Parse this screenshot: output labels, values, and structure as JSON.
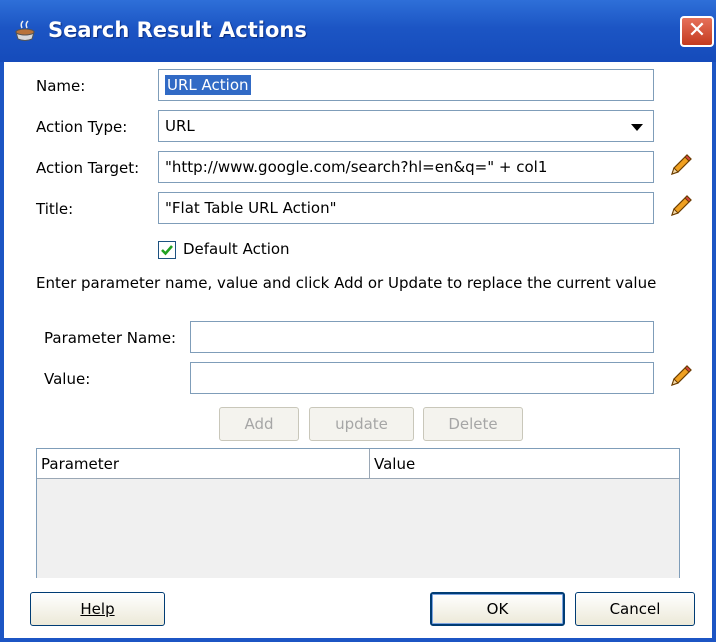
{
  "window": {
    "title": "Search Result Actions",
    "close_glyph": "✕"
  },
  "form": {
    "name_label": "Name:",
    "name_value": "URL Action",
    "action_type_label": "Action Type:",
    "action_type_value": "URL",
    "action_target_label": "Action Target:",
    "action_target_value": "\"http://www.google.com/search?hl=en&q=\" + col1",
    "title_label": "Title:",
    "title_value": "\"Flat Table URL Action\"",
    "default_action_label": "Default Action",
    "default_action_checked": true,
    "instruction": "Enter parameter name, value and click Add or Update to replace the current value",
    "param_name_label": "Parameter Name:",
    "param_name_value": "",
    "value_label": "Value:",
    "value_value": ""
  },
  "param_buttons": {
    "add": "Add",
    "update": "update",
    "delete": "Delete"
  },
  "table": {
    "columns": [
      "Parameter",
      "Value"
    ],
    "rows": []
  },
  "footer": {
    "help": "Help",
    "ok": "OK",
    "cancel": "Cancel"
  },
  "icons": {
    "title_icon": "coffee-cup-icon",
    "edit_icon": "pencil-icon",
    "check_icon": "checkmark-icon"
  }
}
